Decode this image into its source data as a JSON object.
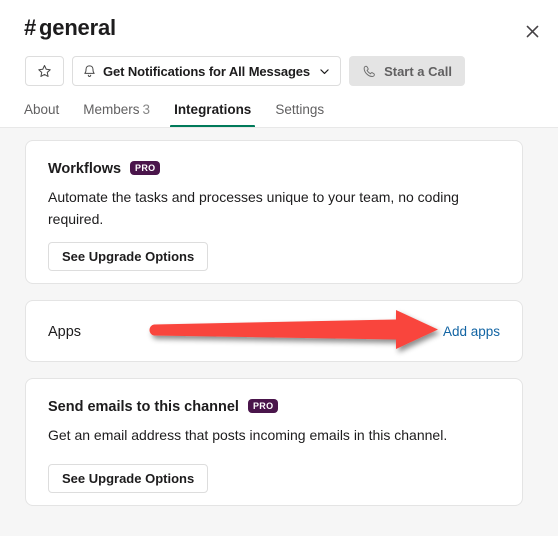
{
  "header": {
    "channel_prefix": "#",
    "channel_name": "general",
    "title": "# general",
    "close_label": "Close",
    "buttons": {
      "star": {
        "icon": "star-icon",
        "label": ""
      },
      "notifications": {
        "icon": "bell-icon",
        "label": "Get Notifications for All Messages",
        "chevron": "chevron-down-icon"
      },
      "start_call": {
        "icon": "phone-icon",
        "label": "Start a Call"
      }
    },
    "tabs": [
      {
        "label": "About",
        "count": "",
        "active": false
      },
      {
        "label": "Members",
        "count": "3",
        "active": false
      },
      {
        "label": "Integrations",
        "count": "",
        "active": true
      },
      {
        "label": "Settings",
        "count": "",
        "active": false
      }
    ]
  },
  "content": {
    "cards": [
      {
        "id": "workflows",
        "title": "Workflows",
        "badge": "PRO",
        "description": "Automate the tasks and processes unique to your team, no coding required.",
        "button_label": "See Upgrade Options"
      },
      {
        "id": "apps",
        "title": "Apps",
        "link_label": "Add apps"
      },
      {
        "id": "emails",
        "title": "Send emails to this channel",
        "badge": "PRO",
        "description": "Get an email address that posts incoming emails in this channel.",
        "button_label": "See Upgrade Options"
      }
    ]
  },
  "annotation": {
    "type": "arrow",
    "direction": "right",
    "color": "#f9453c",
    "points_to": "Add apps"
  },
  "colors": {
    "accent_green": "#007a5a",
    "link_blue": "#1264a3",
    "pro_purple": "#4a154b",
    "annotation_red": "#f9453c",
    "page_background": "#f6f6f6",
    "card_background": "#ffffff",
    "text_primary": "#1d1c1d",
    "text_secondary": "#616061"
  }
}
